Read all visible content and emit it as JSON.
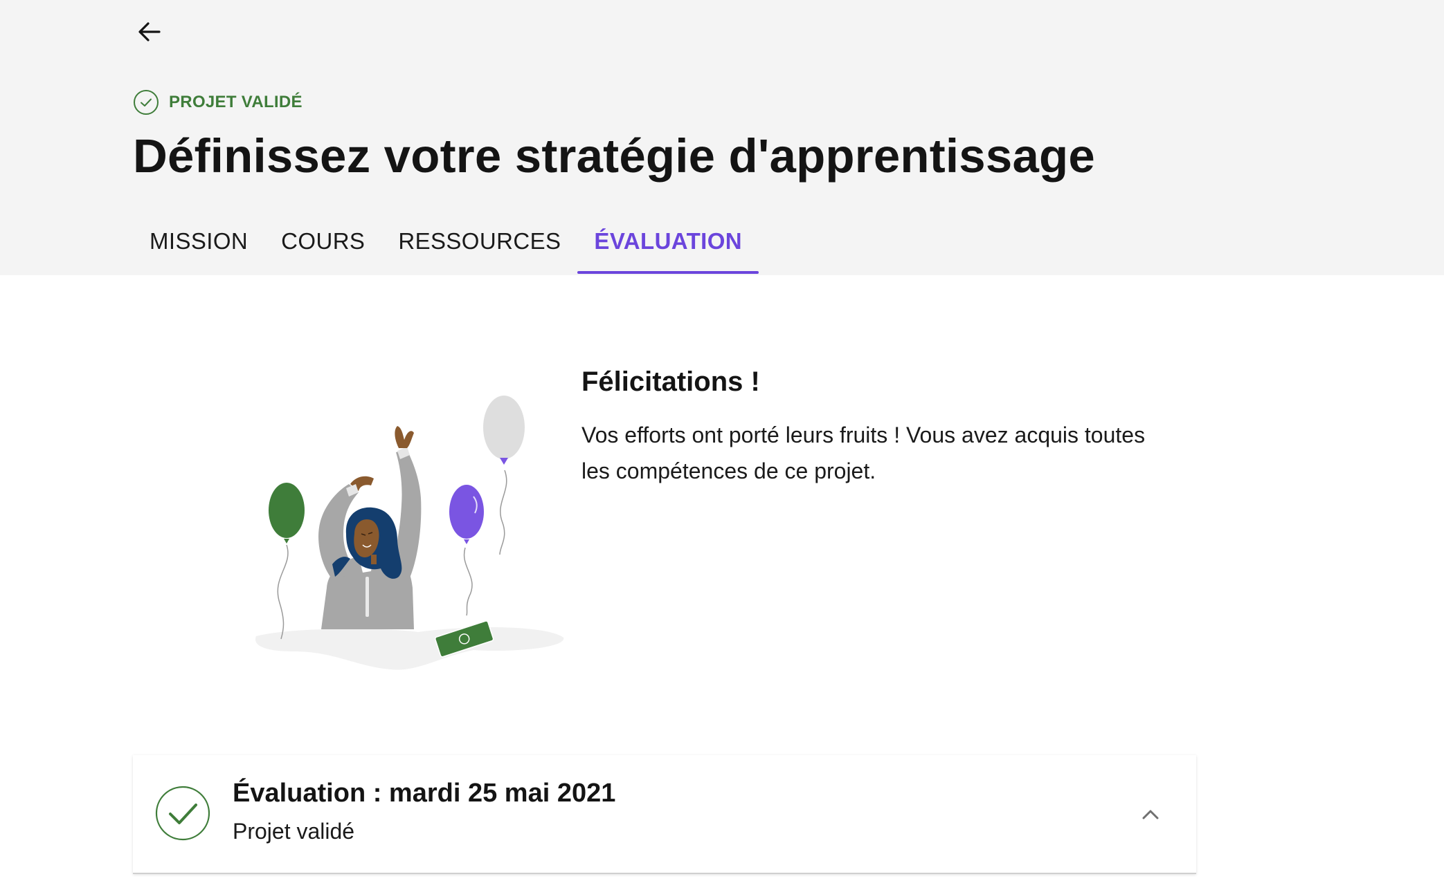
{
  "header": {
    "status_label": "PROJET VALIDÉ",
    "title": "Définissez votre stratégie d'apprentissage",
    "tabs": [
      {
        "label": "MISSION",
        "active": false
      },
      {
        "label": "COURS",
        "active": false
      },
      {
        "label": "RESSOURCES",
        "active": false
      },
      {
        "label": "ÉVALUATION",
        "active": true
      }
    ]
  },
  "congrats": {
    "title": "Félicitations !",
    "body": "Vos efforts ont porté leurs fruits ! Vous avez acquis toutes les compétences de ce projet."
  },
  "evaluation": {
    "title": "Évaluation : mardi 25 mai 2021",
    "status": "Projet validé",
    "expanded": true
  },
  "icons": {
    "back": "arrow-left-icon",
    "status": "check-circle-icon",
    "toggle": "chevron-up-icon"
  },
  "colors": {
    "accent": "#6b45dc",
    "success": "#3f7d3a",
    "header_bg": "#f4f4f4"
  }
}
